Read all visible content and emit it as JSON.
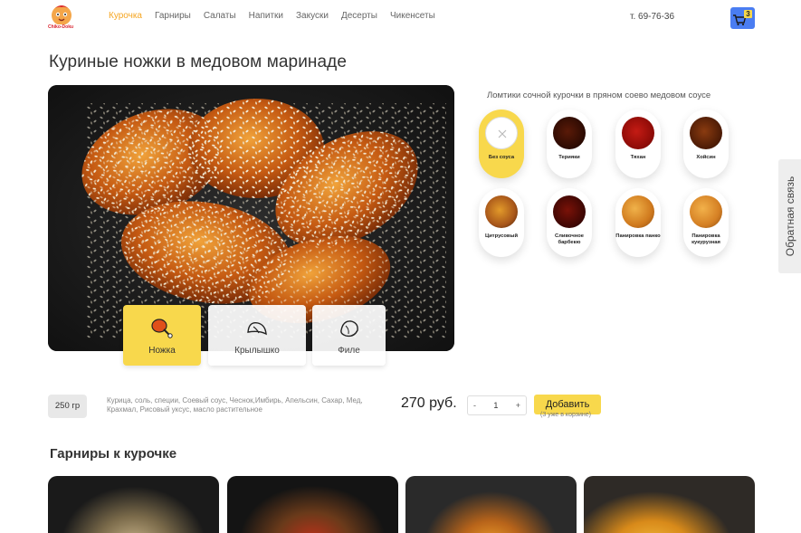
{
  "header": {
    "logo_text": "Chiko-Doku",
    "nav": [
      "Курочка",
      "Гарниры",
      "Салаты",
      "Напитки",
      "Закуски",
      "Десерты",
      "Чикенсеты"
    ],
    "active_nav": "Курочка",
    "phone": "т. 69-76-36",
    "cart_count": "3"
  },
  "product": {
    "title": "Куриные ножки в медовом маринаде",
    "parts": [
      {
        "label": "Ножка",
        "icon": "drumstick-icon",
        "active": true
      },
      {
        "label": "Крылышко",
        "icon": "wing-icon",
        "active": false
      },
      {
        "label": "Филе",
        "icon": "fillet-icon",
        "active": false
      }
    ],
    "weight": "250 гр",
    "ingredients": "Курица, соль, специи, Соевый соус, Чеснок,Имбирь, Апельсин, Сахар, Мед, Крахмал, Рисовый уксус, масло растительное",
    "price": "270 руб.",
    "qty": {
      "minus": "-",
      "value": "1",
      "plus": "+"
    },
    "add_label": "Добавить",
    "in_cart_note": "(3 уже в корзине)"
  },
  "sauces": {
    "title": "Ломтики сочной курочки в пряном соево медовом соусе",
    "items": [
      {
        "label": "Без соуса",
        "kind": "none",
        "active": true
      },
      {
        "label": "Терияки",
        "kind": "dark"
      },
      {
        "label": "Тяхан",
        "kind": "red"
      },
      {
        "label": "Хойсин",
        "kind": "brown"
      },
      {
        "label": "Цитрусовый",
        "kind": "orange"
      },
      {
        "label": "Сливочное барбекю",
        "kind": "bbq"
      },
      {
        "label": "Панировка панко",
        "kind": "panko"
      },
      {
        "label": "Панировка кукурузная",
        "kind": "corn"
      }
    ]
  },
  "feedback_label": "Обратная связь",
  "sides_title": "Гарниры к курочке"
}
